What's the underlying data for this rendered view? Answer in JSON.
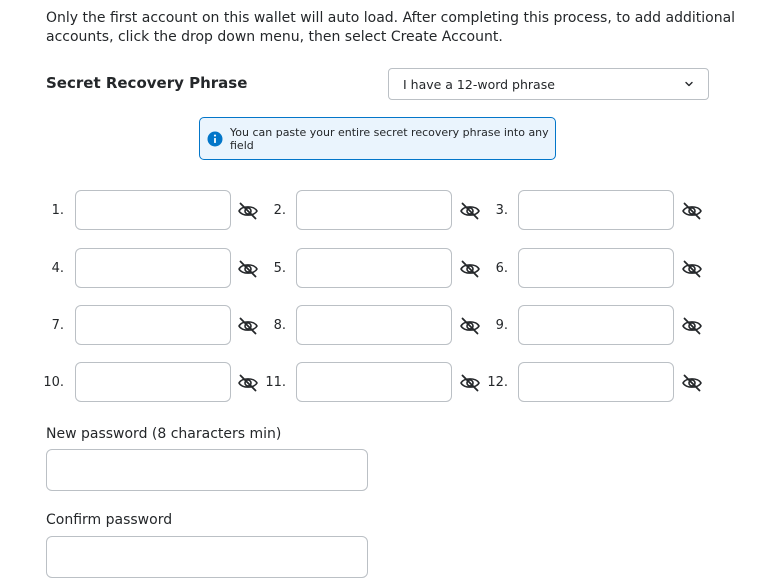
{
  "intro_text": "Only the first account on this wallet will auto load. After completing this process, to add additional accounts, click the drop down menu, then select Create Account.",
  "srp": {
    "title": "Secret Recovery Phrase",
    "select_value": "I have a 12-word phrase",
    "select_icon": "chevron-down-icon",
    "banner_text": "You can paste your entire secret recovery phrase into any field",
    "banner_icon": "info-icon",
    "accent_color": "#0376c9",
    "words": [
      {
        "num": "1.",
        "value": ""
      },
      {
        "num": "2.",
        "value": ""
      },
      {
        "num": "3.",
        "value": ""
      },
      {
        "num": "4.",
        "value": ""
      },
      {
        "num": "5.",
        "value": ""
      },
      {
        "num": "6.",
        "value": ""
      },
      {
        "num": "7.",
        "value": ""
      },
      {
        "num": "8.",
        "value": ""
      },
      {
        "num": "9.",
        "value": ""
      },
      {
        "num": "10.",
        "value": ""
      },
      {
        "num": "11.",
        "value": ""
      },
      {
        "num": "12.",
        "value": ""
      }
    ],
    "toggle_icon": "eye-slash-icon"
  },
  "password": {
    "new_label": "New password (8 characters min)",
    "new_value": "",
    "confirm_label": "Confirm password",
    "confirm_value": ""
  }
}
